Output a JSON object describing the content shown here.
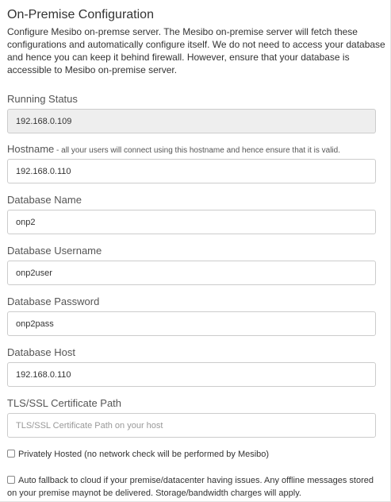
{
  "title": "On-Premise Configuration",
  "description": "Configure Mesibo on-premse server. The Mesibo on-premise server will fetch these configurations and automatically configure itself. We do not need to access your database and hence you can keep it behind firewall. However, ensure that your database is accessible to Mesibo on-premise server.",
  "running_status": {
    "label": "Running Status",
    "value": "192.168.0.109"
  },
  "hostname": {
    "label": "Hostname",
    "hint": " - all your users will connect using this hostname and hence ensure that it is valid.",
    "value": "192.168.0.110"
  },
  "db_name": {
    "label": "Database Name",
    "value": "onp2"
  },
  "db_username": {
    "label": "Database Username",
    "value": "onp2user"
  },
  "db_password": {
    "label": "Database Password",
    "value": "onp2pass"
  },
  "db_host": {
    "label": "Database Host",
    "value": "192.168.0.110"
  },
  "ssl_path": {
    "label": "TLS/SSL Certificate Path",
    "value": "",
    "placeholder": "TLS/SSL Certificate Path on your host"
  },
  "privately_hosted": {
    "label": "Privately Hosted (no network check will be performed by Mesibo)",
    "checked": false
  },
  "auto_fallback": {
    "label": "Auto fallback to cloud if your premise/datacenter having issues. Any offline messages stored on your premise maynot be delivered. Storage/bandwidth charges will apply.",
    "checked": false
  }
}
